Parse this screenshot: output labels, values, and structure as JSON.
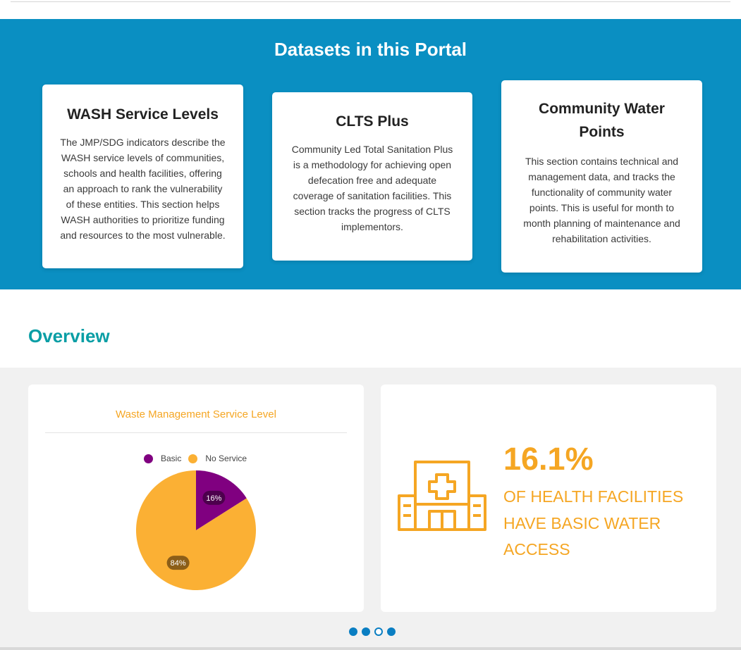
{
  "datasets": {
    "title": "Datasets in this Portal",
    "cards": [
      {
        "title": "WASH Service Levels",
        "description": "The JMP/SDG indicators describe the WASH service levels of communities, schools and health facilities, offering an approach to rank the vulnerability of these entities. This section helps WASH authorities to prioritize funding and resources to the most vulnerable."
      },
      {
        "title": "CLTS Plus",
        "description": "Community Led Total Sanitation Plus is a methodology for achieving open defecation free and adequate coverage of sanitation facilities. This section tracks the progress of CLTS implementors."
      },
      {
        "title": "Community Water Points",
        "description": "This section contains technical and management data, and tracks the functionality of community water points. This is useful for month to month planning of maintenance and rehabilitation activities."
      }
    ]
  },
  "overview": {
    "title": "Overview",
    "stat": {
      "icon": "hospital-icon",
      "value": "16.1%",
      "caption": "OF HEALTH FACILITIES HAVE BASIC WATER ACCESS"
    },
    "carousel": {
      "count": 4,
      "active_index": 2
    }
  },
  "colors": {
    "header_band": "#0a8fc2",
    "overview_title": "#0a9ea5",
    "accent_orange": "#f5a623",
    "basic": "#800080",
    "no_service": "#fbb034",
    "dot": "#0a7ec2"
  },
  "chart_data": {
    "type": "pie",
    "title": "Waste Management Service Level",
    "legend_position": "top",
    "slices": [
      {
        "label": "Basic",
        "value": 16,
        "display": "16%",
        "color": "#800080"
      },
      {
        "label": "No Service",
        "value": 84,
        "display": "84%",
        "color": "#fbb034"
      }
    ]
  }
}
